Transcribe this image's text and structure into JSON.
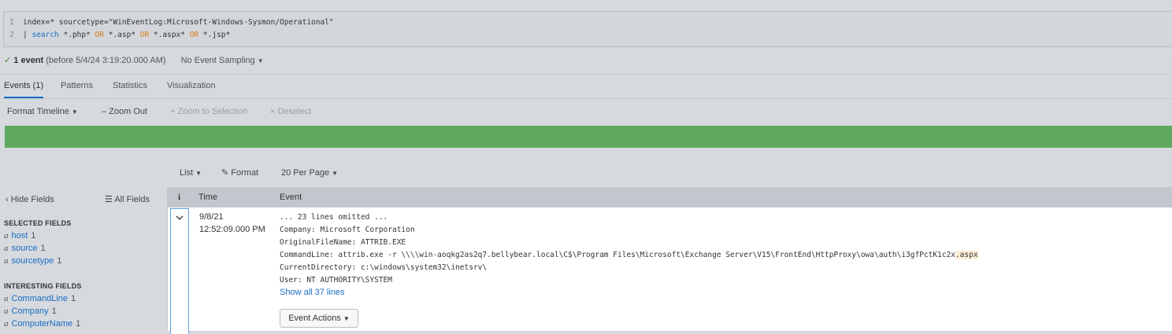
{
  "search": {
    "line1_num": "1",
    "line1_text": "index=* sourcetype=\"WinEventLog:Microsoft-Windows-Sysmon/Operational\"",
    "line2_num": "2",
    "line2_pipe": "| ",
    "line2_cmd": "search",
    "line2_t1": " *.php* ",
    "line2_or1": "OR",
    "line2_t2": " *.asp* ",
    "line2_or2": "OR",
    "line2_t3": " *.aspx* ",
    "line2_or3": "OR",
    "line2_t4": " *.jsp*"
  },
  "meta": {
    "check_icon": "✓",
    "event_count": "1 event",
    "before_text": "(before 5/4/24 3:19:20.000 AM)",
    "sampling": "No Event Sampling"
  },
  "tabs": [
    "Events (1)",
    "Patterns",
    "Statistics",
    "Visualization"
  ],
  "timeline_toolbar": {
    "format_timeline": "Format Timeline",
    "zoom_out": "– Zoom Out",
    "zoom_selection": "+ Zoom to Selection",
    "deselect": "× Deselect"
  },
  "results_toolbar": {
    "list": "List",
    "format": "Format",
    "per_page": "20 Per Page"
  },
  "sidebar": {
    "hide_fields": "Hide Fields",
    "all_fields": "All Fields",
    "selected_title": "SELECTED FIELDS",
    "selected": [
      {
        "type": "a",
        "name": "host",
        "count": "1"
      },
      {
        "type": "a",
        "name": "source",
        "count": "1"
      },
      {
        "type": "a",
        "name": "sourcetype",
        "count": "1"
      }
    ],
    "interesting_title": "INTERESTING FIELDS",
    "interesting": [
      {
        "type": "a",
        "name": "CommandLine",
        "count": "1"
      },
      {
        "type": "a",
        "name": "Company",
        "count": "1"
      },
      {
        "type": "a",
        "name": "ComputerName",
        "count": "1"
      }
    ]
  },
  "table": {
    "col_info": "i",
    "col_time": "Time",
    "col_event": "Event"
  },
  "event": {
    "date": "9/8/21",
    "time": "12:52:09.000 PM",
    "lines": [
      "... 23 lines omitted ...",
      "Company: Microsoft Corporation",
      "OriginalFileName: ATTRIB.EXE"
    ],
    "cmd_prefix": "CommandLine: attrib.exe  -r \\\\\\\\win-aoqkg2as2q7.bellybear.local\\C$\\Program Files\\Microsoft\\Exchange Server\\V15\\FrontEnd\\HttpProxy\\owa\\auth\\i3gfPctK1c2x",
    "cmd_highlight": ".aspx",
    "lines_after": [
      "CurrentDirectory: c:\\windows\\system32\\inetsrv\\",
      "User: NT AUTHORITY\\SYSTEM"
    ],
    "show_all": "Show all 37 lines",
    "actions": "Event Actions"
  },
  "colors": {
    "timeline_bar": "#5ea860",
    "link": "#1a6dc4",
    "highlight": "#fcefd6"
  }
}
